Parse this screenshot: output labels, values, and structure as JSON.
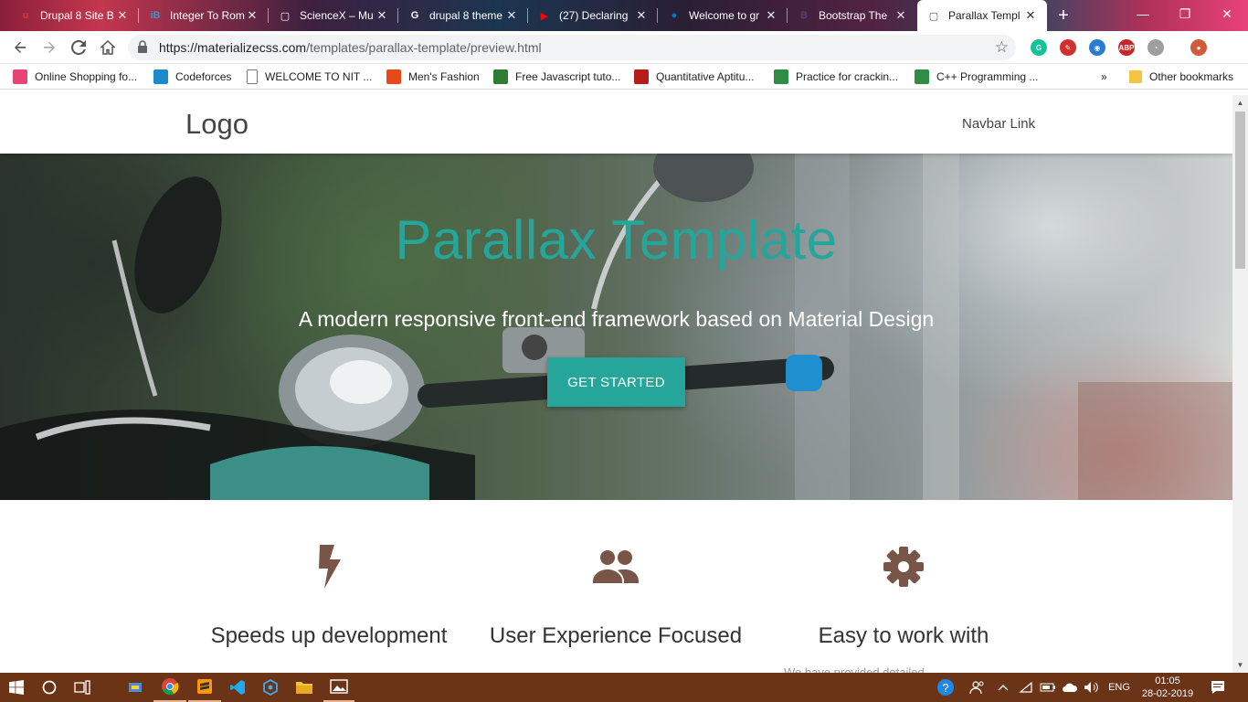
{
  "browser": {
    "tabs": [
      {
        "label": "Drupal 8 Site B",
        "favicon": "drupal-u-icon",
        "favicon_color": "#e0353b",
        "favicon_char": "u"
      },
      {
        "label": "Integer To Rom",
        "favicon": "interviewbit-icon",
        "favicon_color": "#4a90c8",
        "favicon_char": "iB"
      },
      {
        "label": "ScienceX – Mu",
        "favicon": "page-icon",
        "favicon_color": "#ffffff",
        "favicon_char": "▢"
      },
      {
        "label": "drupal 8 theme",
        "favicon": "google-icon",
        "favicon_color": "#ffffff",
        "favicon_char": "G"
      },
      {
        "label": "(27) Declaring",
        "favicon": "youtube-icon",
        "favicon_color": "#ff0000",
        "favicon_char": "▶"
      },
      {
        "label": "Welcome to gr",
        "favicon": "drupal-drop-icon",
        "favicon_color": "#0678be",
        "favicon_char": "●"
      },
      {
        "label": "Bootstrap The",
        "favicon": "bootstrap-icon",
        "favicon_color": "#563d7c",
        "favicon_char": "B"
      },
      {
        "label": "Parallax Templ",
        "favicon": "page-icon",
        "favicon_color": "#555555",
        "favicon_char": "▢",
        "active": true
      }
    ],
    "new_tab_symbol": "+",
    "window_controls": {
      "minimize": "—",
      "restore": "❐",
      "close": "✕"
    },
    "omnibox": {
      "url_host": "https://materializecss.com",
      "url_path": "/templates/parallax-template/preview.html"
    },
    "extensions": [
      {
        "name": "grammarly-icon",
        "color": "#15c39a",
        "char": "G"
      },
      {
        "name": "pen-extension-icon",
        "color": "#d32f2f",
        "char": "✎"
      },
      {
        "name": "eye-extension-icon",
        "color": "#2a7bd4",
        "char": "◉"
      },
      {
        "name": "adblock-icon",
        "color": "#c62828",
        "char": "ABP"
      },
      {
        "name": "clock-extension-icon",
        "color": "#9e9e9e",
        "char": "◔"
      },
      {
        "name": "profile-avatar-icon",
        "color": "#d05a3a",
        "char": "●"
      }
    ],
    "bookmarks": [
      {
        "label": "Online Shopping fo...",
        "icon": "myntra-icon",
        "color": "#e54474"
      },
      {
        "label": "Codeforces",
        "icon": "codeforces-icon",
        "color": "#1f8acb"
      },
      {
        "label": "WELCOME TO NIT ...",
        "icon": "page-icon",
        "color": "#ffffff"
      },
      {
        "label": "Men's Fashion",
        "icon": "fashion-icon",
        "color": "#e64a19"
      },
      {
        "label": "Free Javascript tuto...",
        "icon": "play-icon",
        "color": "#2e7d32"
      },
      {
        "label": "Quantitative Aptitu...",
        "icon": "aptitude-icon",
        "color": "#b71c1c"
      },
      {
        "label": "Practice for crackin...",
        "icon": "gfg-icon",
        "color": "#2f8d46"
      },
      {
        "label": "C++ Programming ...",
        "icon": "gfg-icon",
        "color": "#2f8d46"
      }
    ],
    "bookmarks_overflow": "»",
    "other_bookmarks": "Other bookmarks"
  },
  "site": {
    "logo": "Logo",
    "nav_link": "Navbar Link",
    "hero": {
      "title": "Parallax Template",
      "subtitle": "A modern responsive front-end framework based on Material Design",
      "cta": "GET STARTED"
    },
    "features": [
      {
        "icon": "flash-icon",
        "title": "Speeds up development",
        "text": ""
      },
      {
        "icon": "group-icon",
        "title": "User Experience Focused",
        "text": ""
      },
      {
        "icon": "settings-icon",
        "title": "Easy to work with",
        "text": "We have provided detailed"
      }
    ],
    "accent_color": "#26a69a",
    "icon_color": "#795548"
  },
  "taskbar": {
    "language": "ENG",
    "time": "01:05",
    "date": "28-02-2019"
  }
}
